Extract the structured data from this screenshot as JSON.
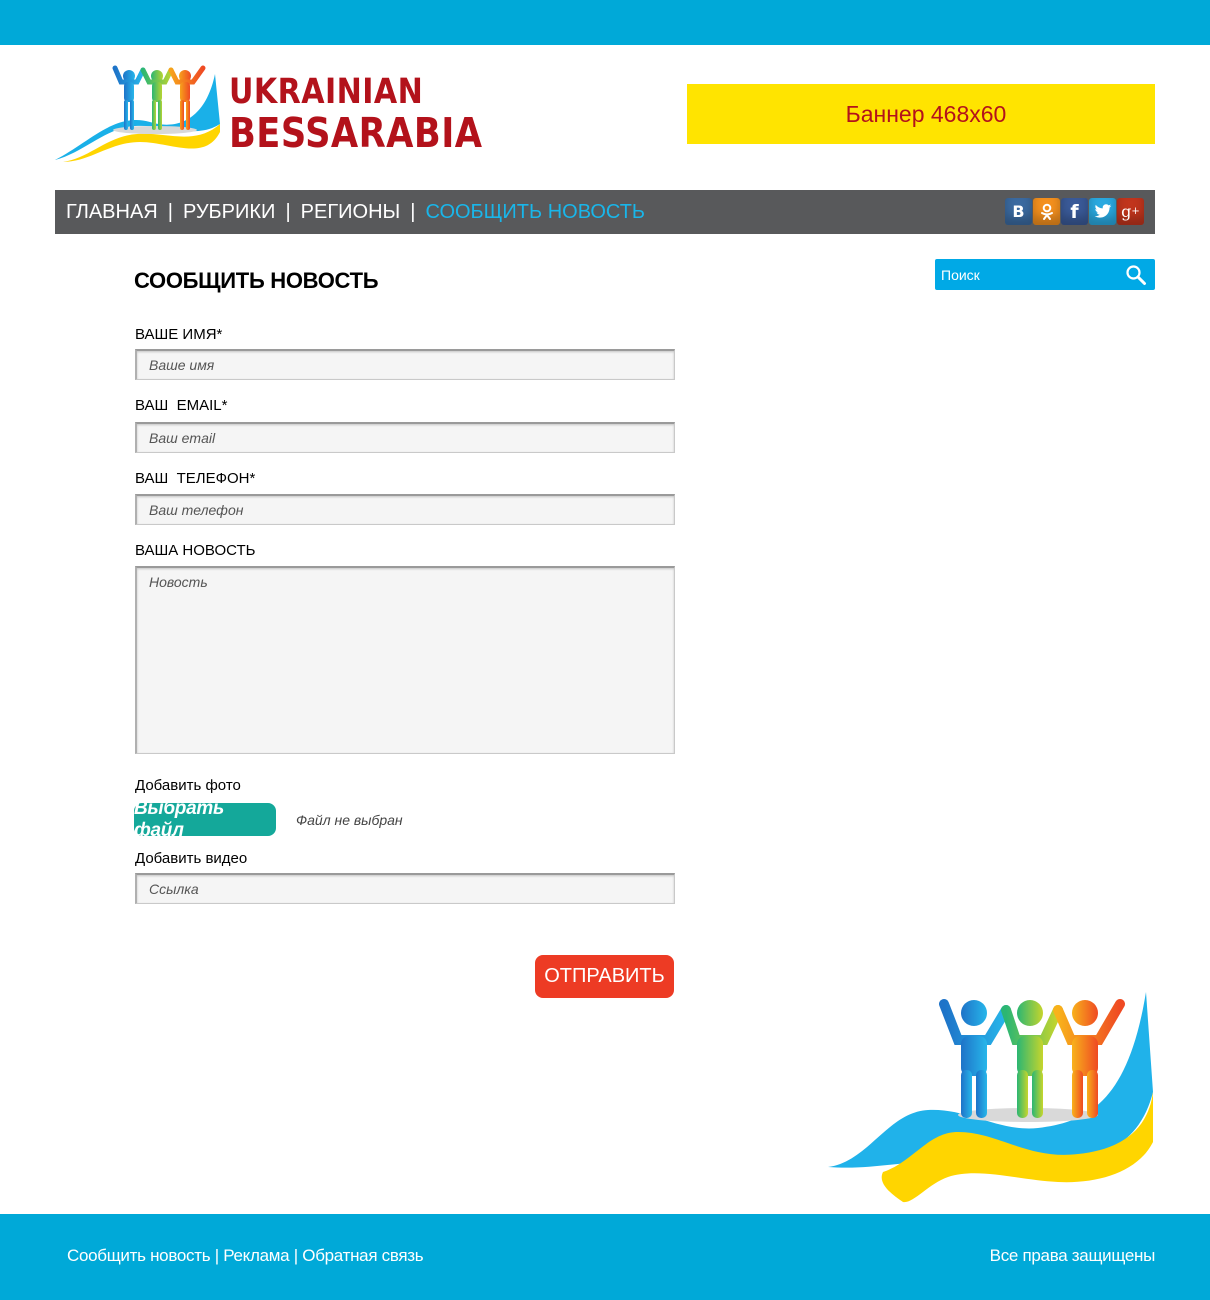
{
  "header": {
    "logo_line1": "UKRAINIAN",
    "logo_line2": "BESSARABIA",
    "banner_text": "Баннер 468x60"
  },
  "nav": {
    "items": [
      {
        "label": "ГЛАВНАЯ"
      },
      {
        "label": "РУБРИКИ"
      },
      {
        "label": "РЕГИОНЫ"
      },
      {
        "label": "СООБЩИТЬ НОВОСТЬ",
        "active": true
      }
    ],
    "separator": "|",
    "socials": [
      {
        "icon": "vk-icon",
        "glyph": "B",
        "color": "#3b6aa0"
      },
      {
        "icon": "odnoklassniki-icon",
        "glyph": "ok",
        "color": "#f4901e"
      },
      {
        "icon": "facebook-icon",
        "glyph": "f",
        "color": "#3a5a98"
      },
      {
        "icon": "twitter-icon",
        "glyph": "t",
        "color": "#2aa9e0"
      },
      {
        "icon": "google-plus-icon",
        "glyph": "g+",
        "color": "#c1351d"
      }
    ]
  },
  "search": {
    "placeholder": "Поиск",
    "icon": "search-icon"
  },
  "form": {
    "title": "СООБЩИТЬ НОВОСТЬ",
    "name_label": "ВАШЕ ИМЯ*",
    "name_placeholder": "Ваше имя",
    "email_label": "ВАШ  EMAIL*",
    "email_placeholder": "Ваш email",
    "phone_label": "ВАШ  ТЕЛЕФОН*",
    "phone_placeholder": "Ваш телефон",
    "news_label": "ВАША НОВОСТЬ",
    "news_placeholder": "Новость",
    "photo_label": "Добавить фото",
    "file_button": "Выбрать файл",
    "file_status": "Файл не выбран",
    "video_label": "Добавить видео",
    "video_placeholder": "Ссылка",
    "submit": "ОТПРАВИТЬ"
  },
  "footer": {
    "links": [
      "Сообщить новость",
      "Реклама",
      "Обратная связь"
    ],
    "separator": " | ",
    "copyright": "Все права защищены"
  },
  "colors": {
    "accent_blue": "#00a9d8",
    "nav_gray": "#58595b",
    "brand_red": "#b3121b",
    "banner_yellow": "#ffe400",
    "file_button_teal": "#14a89a",
    "submit_red": "#ed3b24"
  }
}
